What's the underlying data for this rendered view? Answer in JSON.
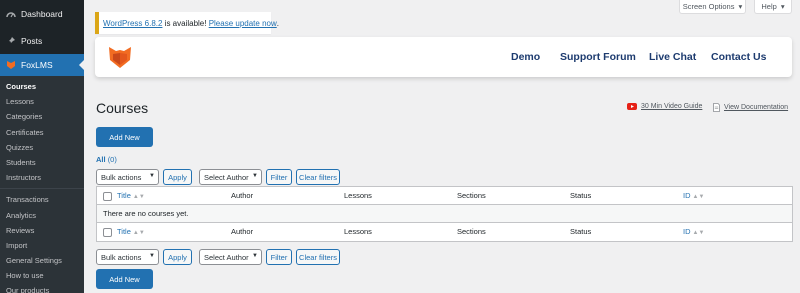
{
  "sidebar": {
    "dashboard_label": "Dashboard",
    "posts_label": "Posts",
    "foxlms_label": "FoxLMS",
    "submenu_group1": [
      "Courses",
      "Lessons",
      "Categories",
      "Certificates",
      "Quizzes",
      "Students",
      "Instructors"
    ],
    "submenu_group2": [
      "Transactions",
      "Analytics",
      "Reviews",
      "Import",
      "General Settings",
      "How to use",
      "Our products"
    ]
  },
  "top": {
    "screen_options": "Screen Options",
    "help": "Help"
  },
  "notice": {
    "link_version": "WordPress 6.8.2",
    "middle_text": " is available! ",
    "link_update": "Please update now",
    "end_text": "."
  },
  "lms_header": {
    "nav": [
      "Demo",
      "Support Forum",
      "Live Chat",
      "Contact Us"
    ]
  },
  "page": {
    "title": "Courses",
    "video_guide": "30 Min Video Guide",
    "view_docs": "View Documentation",
    "add_new": "Add New",
    "filter_all": "All",
    "filter_count": "(0)"
  },
  "controls": {
    "bulk_actions": "Bulk actions",
    "apply": "Apply",
    "select_author": "Select Author",
    "filter": "Filter",
    "clear_filters": "Clear filters"
  },
  "table": {
    "columns": [
      "Title",
      "Author",
      "Lessons",
      "Sections",
      "Status",
      "ID"
    ],
    "empty_message": "There are no courses yet."
  },
  "colors": {
    "sidebar_bg": "#1d2327",
    "accent": "#2271b1",
    "brand_orange": "#f26c22"
  }
}
